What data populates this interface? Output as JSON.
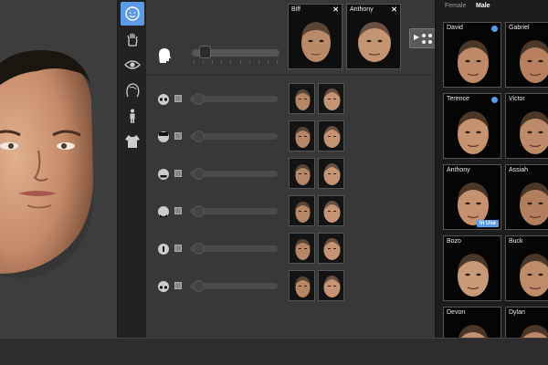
{
  "colors": {
    "accent": "#5b9ae6",
    "viewport_bg": "#3d3d3d",
    "editor_bg": "#383838",
    "browser_bg": "#1d1d1d"
  },
  "toolstrip": {
    "tools": [
      {
        "icon": "face-icon",
        "active": true
      },
      {
        "icon": "hand-icon",
        "active": false
      },
      {
        "icon": "eye-icon",
        "active": false
      },
      {
        "icon": "hair-icon",
        "active": false
      },
      {
        "icon": "body-icon",
        "active": false
      },
      {
        "icon": "clothing-icon",
        "active": false
      }
    ]
  },
  "selected_slots": [
    {
      "name": "Biff",
      "close": "✕"
    },
    {
      "name": "Anthony",
      "close": "✕"
    }
  ],
  "master": {
    "icon": "head-silhouette-icon",
    "value": 0.05
  },
  "feature_rows": [
    {
      "icon": "face-region-eyes-icon",
      "value": 0.05
    },
    {
      "icon": "face-region-forehead-icon",
      "value": 0.05
    },
    {
      "icon": "face-region-mouth-icon",
      "value": 0.05
    },
    {
      "icon": "face-region-chin-icon",
      "value": 0.05
    },
    {
      "icon": "face-region-nose-icon",
      "value": 0.05
    },
    {
      "icon": "face-region-eyes-lower-icon",
      "value": 0.05
    }
  ],
  "browser": {
    "tabs": [
      {
        "label": "Female",
        "active": false
      },
      {
        "label": "Male",
        "active": true
      }
    ],
    "cards": [
      {
        "name": "David",
        "badge": true,
        "in_use": false
      },
      {
        "name": "Gabriel",
        "badge": false,
        "in_use": false
      },
      {
        "name": "Terence",
        "badge": true,
        "in_use": false
      },
      {
        "name": "Victor",
        "badge": false,
        "in_use": false
      },
      {
        "name": "Anthony",
        "badge": false,
        "in_use": true,
        "in_use_label": "In Use"
      },
      {
        "name": "Assiah",
        "badge": false,
        "in_use": false
      },
      {
        "name": "Bozo",
        "badge": false,
        "in_use": false
      },
      {
        "name": "Buck",
        "badge": false,
        "in_use": false
      },
      {
        "name": "Devon",
        "badge": false,
        "in_use": false
      },
      {
        "name": "Dylan",
        "badge": false,
        "in_use": false
      }
    ]
  }
}
